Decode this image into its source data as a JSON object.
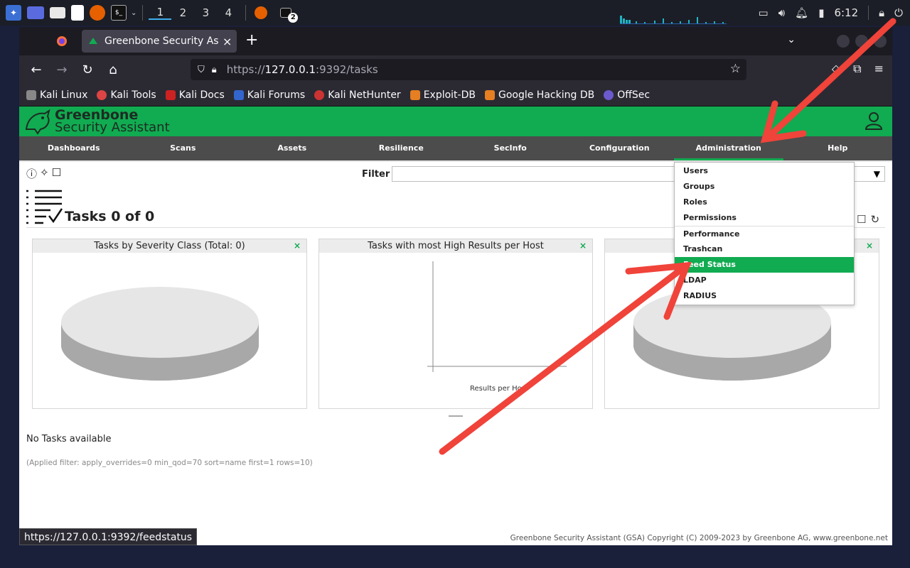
{
  "taskbar": {
    "workspaces": [
      "1",
      "2",
      "3",
      "4"
    ],
    "terminal_badge": "2",
    "clock": "6:12"
  },
  "browser": {
    "tab_title": "Greenbone Security Assistant",
    "url_prefix": "https://",
    "url_host": "127.0.0.1",
    "url_rest": ":9392/tasks",
    "bookmarks": [
      "Kali Linux",
      "Kali Tools",
      "Kali Docs",
      "Kali Forums",
      "Kali NetHunter",
      "Exploit-DB",
      "Google Hacking DB",
      "OffSec"
    ],
    "status_url": "https://127.0.0.1:9392/feedstatus"
  },
  "gsa": {
    "logo_line1": "Greenbone",
    "logo_line2": "Security Assistant",
    "menu": [
      "Dashboards",
      "Scans",
      "Assets",
      "Resilience",
      "SecInfo",
      "Configuration",
      "Administration",
      "Help"
    ],
    "filter_label": "Filter",
    "page_title": "Tasks 0 of 0",
    "dashboards": [
      {
        "title": "Tasks by Severity Class (Total: 0)"
      },
      {
        "title": "Tasks with most High Results per Host",
        "xlabel": "Results per Host"
      },
      {
        "title": ""
      }
    ],
    "close_glyph": "×",
    "no_tasks": "No Tasks available",
    "applied_filter": "(Applied filter: apply_overrides=0 min_qod=70 sort=name first=1 rows=10)",
    "copyright": "Greenbone Security Assistant (GSA) Copyright (C) 2009-2023 by Greenbone AG, www.greenbone.net",
    "admin_dropdown": [
      "Users",
      "Groups",
      "Roles",
      "Permissions",
      "Performance",
      "Trashcan",
      "Feed Status",
      "LDAP",
      "RADIUS"
    ],
    "active_dropdown_item": "Feed Status"
  },
  "colors": {
    "gsa_green": "#11ab51",
    "annotation_red": "#f0433a"
  }
}
